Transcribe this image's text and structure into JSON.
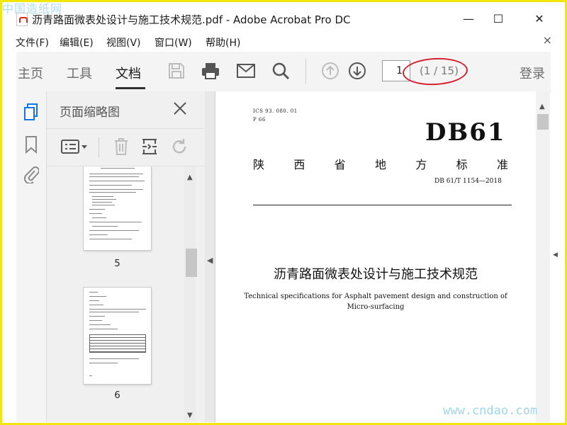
{
  "window": {
    "title": "沥青路面微表处设计与施工技术规范.pdf - Adobe Acrobat Pro DC",
    "watermark_top": "中国造纸网",
    "minimize": "—",
    "maximize": "☐",
    "close": "✕"
  },
  "menu": {
    "items": [
      "文件(F)",
      "编辑(E)",
      "视图(V)",
      "窗口(W)",
      "帮助(H)"
    ],
    "close": "×"
  },
  "toolbar": {
    "tabs": [
      "主页",
      "工具",
      "文档"
    ],
    "active_tab": "文档",
    "page_number": "1",
    "page_count": "(1 / 15)",
    "login": "登录"
  },
  "panel": {
    "title": "页面缩略图",
    "thumbnails": [
      {
        "label": "5"
      },
      {
        "label": "6"
      }
    ]
  },
  "document": {
    "ics": "ICS 93. 080. 01",
    "p": "P 66",
    "code": "DB61",
    "org": [
      "陕",
      "西",
      "省",
      "地",
      "方",
      "标",
      "准"
    ],
    "number": "DB 61/T 1154—2018",
    "title_cn": "沥青路面微表处设计与施工技术规范",
    "title_en_1": "Technical specifications for Asphalt pavement design and construction of",
    "title_en_2": "Micro-surfacing"
  },
  "watermark_bottom": "www.cndao.com",
  "colors": {
    "frame": "#f2e70a",
    "annotation": "#d4202f",
    "accent_blue": "#1473e6"
  }
}
